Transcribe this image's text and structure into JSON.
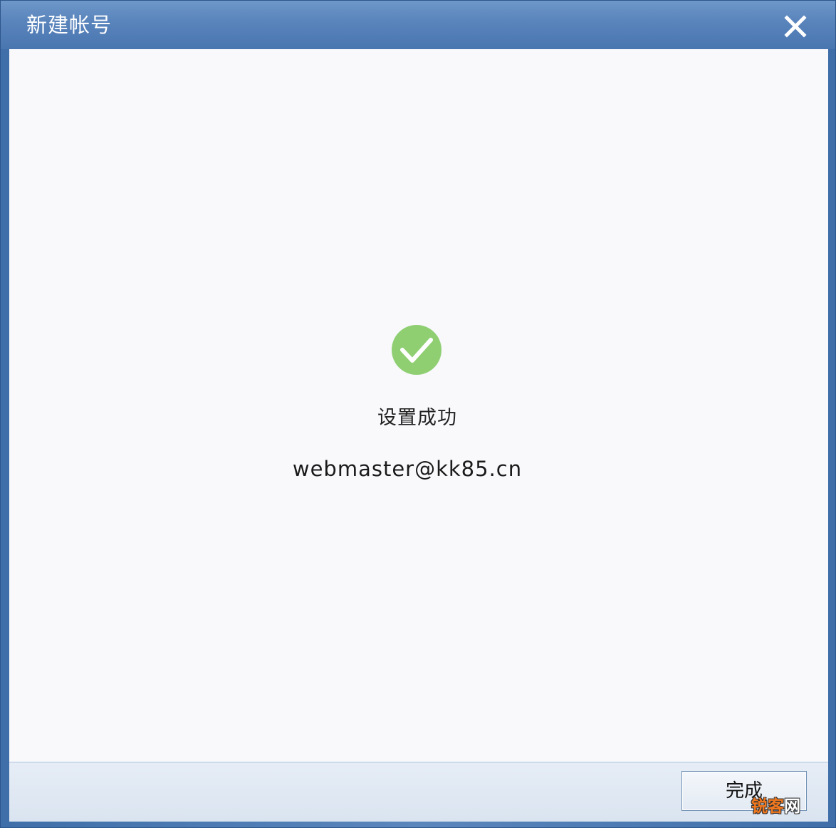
{
  "window": {
    "title": "新建帐号",
    "close_icon": "close-icon"
  },
  "result": {
    "icon": "checkmark-circle-icon",
    "icon_color": "#8fcf72",
    "status": "设置成功",
    "account": "webmaster@kk85.cn"
  },
  "footer": {
    "finish_label": "完成"
  },
  "watermark": {
    "part1": "锐客",
    "part2": "网"
  }
}
